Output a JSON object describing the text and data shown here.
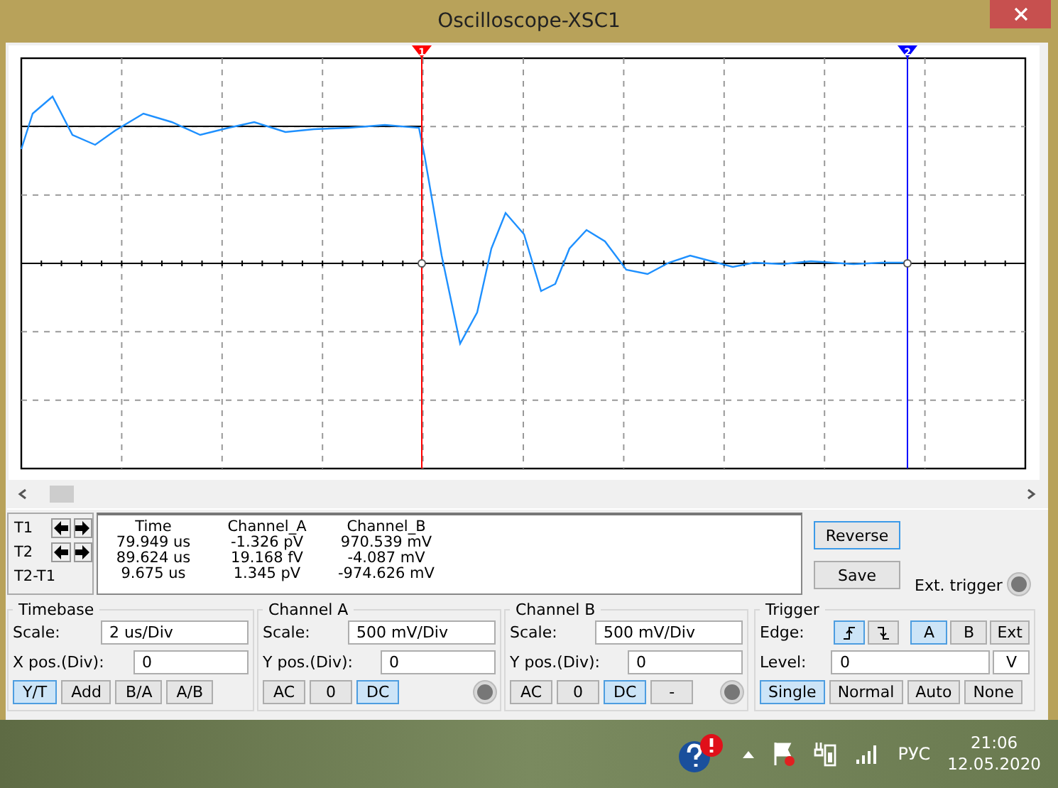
{
  "window": {
    "title": "Oscilloscope-XSC1"
  },
  "cursors": [
    {
      "label": "1",
      "color": "#ff0000"
    },
    {
      "label": "2",
      "color": "#0000ff"
    }
  ],
  "readout": {
    "cursor_labels": [
      "T1",
      "T2",
      "T2-T1"
    ],
    "columns": [
      "Time",
      "Channel_A",
      "Channel_B"
    ],
    "rows": [
      [
        "79.949 us",
        "-1.326 pV",
        "970.539 mV"
      ],
      [
        "89.624 us",
        "19.168 fV",
        "-4.087 mV"
      ],
      [
        "9.675 us",
        "1.345 pV",
        "-974.626 mV"
      ]
    ]
  },
  "actions": [
    {
      "label": "Reverse",
      "selected": true
    },
    {
      "label": "Save",
      "selected": false
    }
  ],
  "ext_trigger": "Ext. trigger",
  "timebase": {
    "title": "Timebase",
    "scale_label": "Scale:",
    "scale_value": "2 us/Div",
    "pos_label": "X pos.(Div):",
    "pos_value": "0",
    "modes": [
      {
        "label": "Y/T",
        "selected": true
      },
      {
        "label": "Add",
        "selected": false
      },
      {
        "label": "B/A",
        "selected": false
      },
      {
        "label": "A/B",
        "selected": false
      }
    ]
  },
  "channels": [
    {
      "title": "Channel A",
      "scale_label": "Scale:",
      "scale_value": "500 mV/Div",
      "pos_label": "Y pos.(Div):",
      "pos_value": "0",
      "coupling": [
        {
          "label": "AC",
          "selected": false
        },
        {
          "label": "0",
          "selected": false
        },
        {
          "label": "DC",
          "selected": true
        }
      ]
    },
    {
      "title": "Channel B",
      "scale_label": "Scale:",
      "scale_value": "500 mV/Div",
      "pos_label": "Y pos.(Div):",
      "pos_value": "0",
      "coupling": [
        {
          "label": "AC",
          "selected": false
        },
        {
          "label": "0",
          "selected": false
        },
        {
          "label": "DC",
          "selected": true
        },
        {
          "label": "-",
          "selected": false
        }
      ]
    }
  ],
  "trigger": {
    "title": "Trigger",
    "edge_label": "Edge:",
    "edges": [
      {
        "kind": "rising",
        "selected": true
      },
      {
        "kind": "falling",
        "selected": false
      }
    ],
    "sources": [
      {
        "label": "A",
        "selected": true
      },
      {
        "label": "B",
        "selected": false
      },
      {
        "label": "Ext",
        "selected": false
      }
    ],
    "level_label": "Level:",
    "level_value": "0",
    "level_unit": "V",
    "modes": [
      {
        "label": "Single",
        "selected": true
      },
      {
        "label": "Normal",
        "selected": false
      },
      {
        "label": "Auto",
        "selected": false
      },
      {
        "label": "None",
        "selected": false
      }
    ]
  },
  "taskbar": {
    "language": "РУС",
    "time": "21:06",
    "date": "12.05.2020"
  }
}
